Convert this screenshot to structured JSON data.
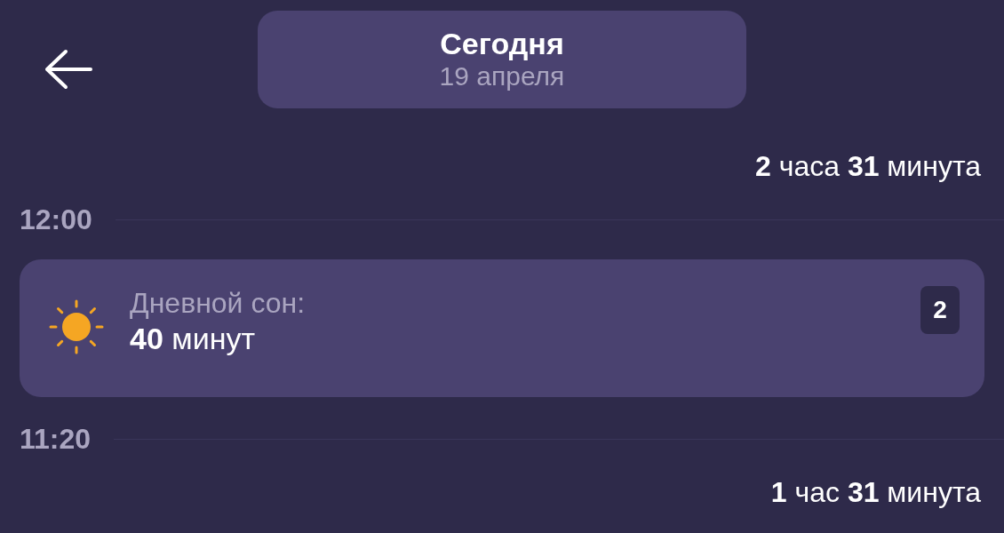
{
  "header": {
    "title": "Сегодня",
    "date": "19 апреля"
  },
  "timeline": [
    {
      "kind": "duration",
      "text": "**2** часа **31** минута"
    },
    {
      "kind": "time",
      "text": "12:00"
    },
    {
      "kind": "event",
      "label": "Дневной сон:",
      "value": "**40** минут",
      "badge": "2"
    },
    {
      "kind": "time",
      "text": "11:20"
    },
    {
      "kind": "duration",
      "text": "**1** час **31** минута"
    }
  ]
}
